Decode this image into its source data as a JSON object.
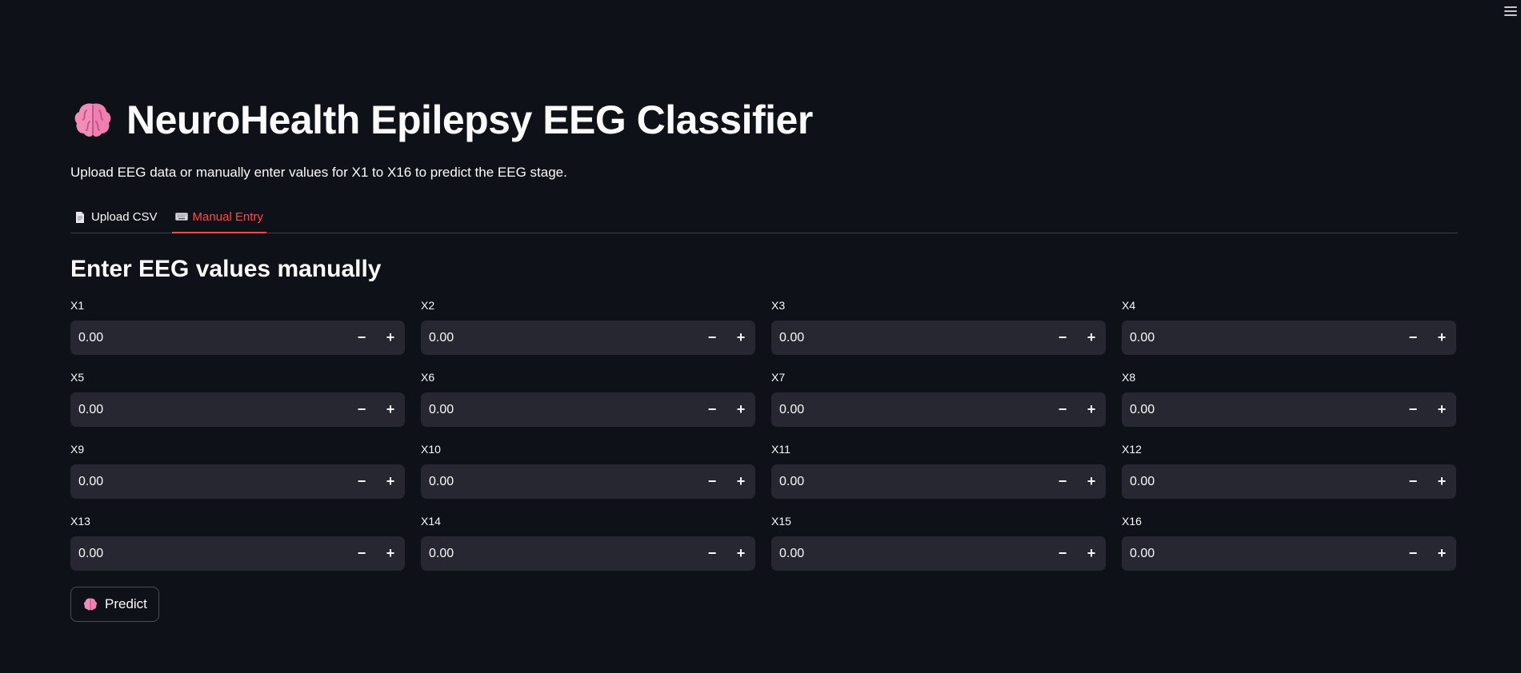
{
  "header": {
    "title": "NeuroHealth Epilepsy EEG Classifier",
    "title_icon": "brain-icon",
    "subtitle": "Upload EEG data or manually enter values for X1 to X16 to predict the EEG stage."
  },
  "tabs": [
    {
      "label": "Upload CSV",
      "icon": "document-icon",
      "active": false
    },
    {
      "label": "Manual Entry",
      "icon": "keyboard-icon",
      "active": true
    }
  ],
  "manual": {
    "heading": "Enter EEG values manually",
    "fields": [
      {
        "label": "X1",
        "value": "0.00"
      },
      {
        "label": "X2",
        "value": "0.00"
      },
      {
        "label": "X3",
        "value": "0.00"
      },
      {
        "label": "X4",
        "value": "0.00"
      },
      {
        "label": "X5",
        "value": "0.00"
      },
      {
        "label": "X6",
        "value": "0.00"
      },
      {
        "label": "X7",
        "value": "0.00"
      },
      {
        "label": "X8",
        "value": "0.00"
      },
      {
        "label": "X9",
        "value": "0.00"
      },
      {
        "label": "X10",
        "value": "0.00"
      },
      {
        "label": "X11",
        "value": "0.00"
      },
      {
        "label": "X12",
        "value": "0.00"
      },
      {
        "label": "X13",
        "value": "0.00"
      },
      {
        "label": "X14",
        "value": "0.00"
      },
      {
        "label": "X15",
        "value": "0.00"
      },
      {
        "label": "X16",
        "value": "0.00"
      }
    ],
    "predict_label": "Predict",
    "predict_icon": "brain-icon"
  },
  "stepper": {
    "minus": "−",
    "plus": "+"
  },
  "colors": {
    "background": "#0e1117",
    "input_bg": "#262730",
    "accent": "#ff4b4b",
    "text": "#fafafa",
    "brain": "#f28cb8"
  }
}
